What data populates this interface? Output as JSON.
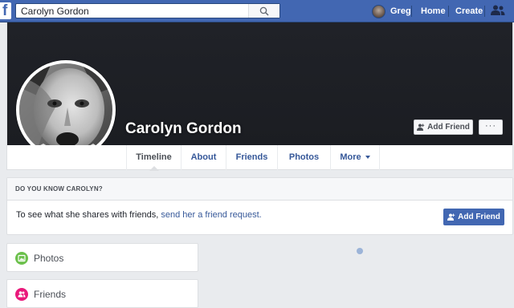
{
  "topbar": {
    "logo": "f",
    "search_value": "Carolyn Gordon",
    "search_icon": "search-icon",
    "user_name": "Greg",
    "nav": [
      "Home",
      "Create"
    ],
    "friends_icon": "friend-requests-icon",
    "color": "#4267b2"
  },
  "profile": {
    "name": "Carolyn Gordon",
    "add_friend_label": "Add Friend",
    "more_label": "···"
  },
  "tabs": [
    {
      "label": "Timeline",
      "active": true
    },
    {
      "label": "About"
    },
    {
      "label": "Friends"
    },
    {
      "label": "Photos"
    },
    {
      "label": "More"
    }
  ],
  "know": {
    "header": "DO YOU KNOW CAROLYN?",
    "message_prefix": "To see what she shares with friends, ",
    "message_link": "send her a friend request.",
    "button_label": "Add Friend"
  },
  "cards": [
    {
      "label": "Photos",
      "icon": "photos-icon",
      "color": "#6bc04b"
    },
    {
      "label": "Friends",
      "icon": "friends-icon",
      "color": "#e9197b"
    }
  ]
}
